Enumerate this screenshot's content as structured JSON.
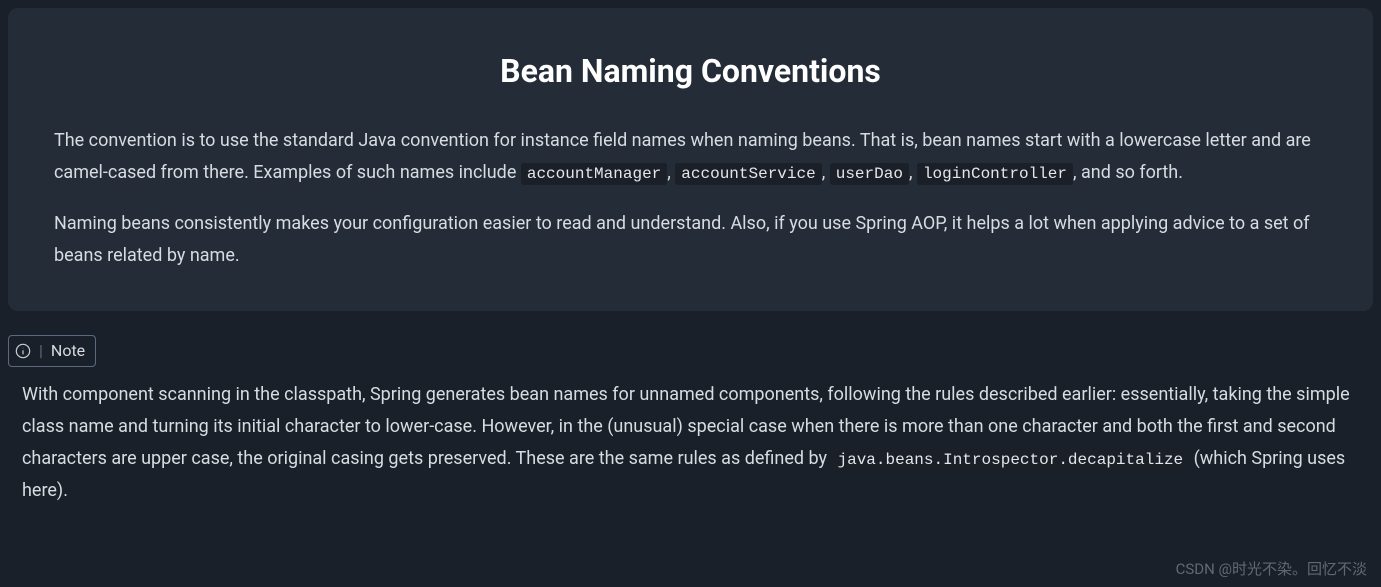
{
  "section": {
    "title": "Bean Naming Conventions",
    "para1": {
      "pre": "The convention is to use the standard Java convention for instance field names when naming beans. That is, bean names start with a lowercase letter and are camel-cased from there. Examples of such names include ",
      "examples": [
        "accountManager",
        "accountService",
        "userDao",
        "loginController"
      ],
      "post": ", and so forth."
    },
    "para2": "Naming beans consistently makes your configuration easier to read and understand. Also, if you use Spring AOP, it helps a lot when applying advice to a set of beans related by name."
  },
  "note": {
    "label": "Note",
    "body": {
      "pre": "With component scanning in the classpath, Spring generates bean names for unnamed components, following the rules described earlier: essentially, taking the simple class name and turning its initial character to lower-case. However, in the (unusual) special case when there is more than one character and both the first and second characters are upper case, the original casing gets preserved. These are the same rules as defined by ",
      "code": "java.beans.Introspector.decapitalize",
      "post": " (which Spring uses here)."
    }
  },
  "watermark": "CSDN @时光不染。回忆不淡"
}
